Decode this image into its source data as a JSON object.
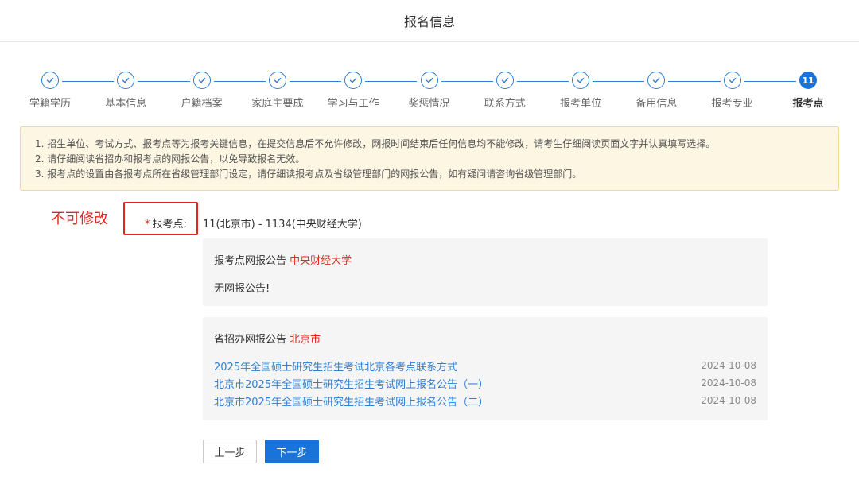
{
  "header": {
    "title": "报名信息"
  },
  "steps": [
    {
      "label": "学籍学历",
      "done": true
    },
    {
      "label": "基本信息",
      "done": true
    },
    {
      "label": "户籍档案",
      "done": true
    },
    {
      "label": "家庭主要成",
      "done": true
    },
    {
      "label": "学习与工作",
      "done": true
    },
    {
      "label": "奖惩情况",
      "done": true
    },
    {
      "label": "联系方式",
      "done": true
    },
    {
      "label": "报考单位",
      "done": true
    },
    {
      "label": "备用信息",
      "done": true
    },
    {
      "label": "报考专业",
      "done": true
    },
    {
      "label": "报考点",
      "done": false,
      "number": "11"
    }
  ],
  "notice": {
    "lines": [
      "1. 招生单位、考试方式、报考点等为报考关键信息，在提交信息后不允许修改，网报时间结束后任何信息均不能修改，请考生仔细阅读页面文字并认真填写选择。",
      "2. 请仔细阅读省招办和报考点的网报公告，以免导致报名无效。",
      "3. 报考点的设置由各报考点所在省级管理部门设定，请仔细读报考点及省级管理部门的网报公告，如有疑问请咨询省级管理部门。"
    ]
  },
  "annotation": {
    "text": "不可修改"
  },
  "field": {
    "required_mark": "*",
    "label": "报考点:",
    "value": "11(北京市)  -  1134(中央财经大学)"
  },
  "site_notice": {
    "title": "报考点网报公告",
    "org": "中央财经大学",
    "body": "无网报公告!"
  },
  "province_notice": {
    "title": "省招办网报公告",
    "org": "北京市",
    "items": [
      {
        "text": "2025年全国硕士研究生招生考试北京各考点联系方式",
        "date": "2024-10-08"
      },
      {
        "text": "北京市2025年全国硕士研究生招生考试网上报名公告（一）",
        "date": "2024-10-08"
      },
      {
        "text": "北京市2025年全国硕士研究生招生考试网上报名公告（二）",
        "date": "2024-10-08"
      }
    ]
  },
  "buttons": {
    "prev": "上一步",
    "next": "下一步"
  },
  "colors": {
    "primary": "#1a73d9",
    "accent_red": "#e0281f",
    "notice_bg": "#fdf6e3"
  }
}
